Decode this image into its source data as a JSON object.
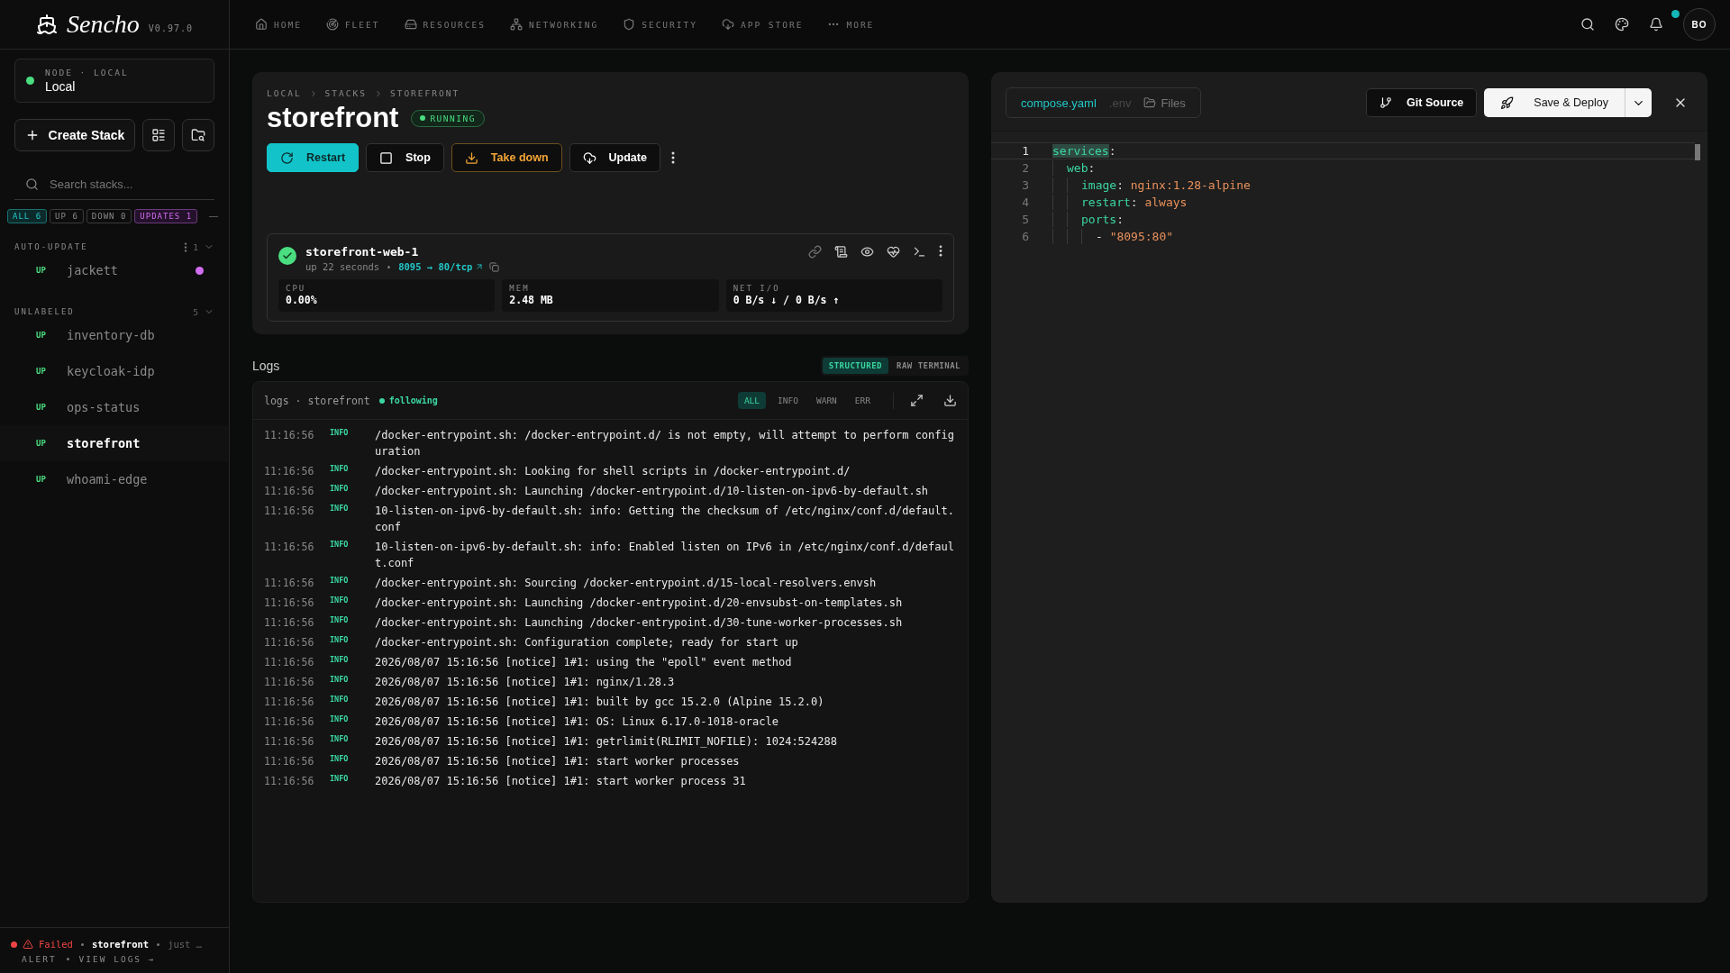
{
  "brand": {
    "name": "Sencho",
    "version": "V0.97.0"
  },
  "node": {
    "label": "NODE · LOCAL",
    "name": "Local",
    "online": true
  },
  "sidebar": {
    "create_label": "Create Stack",
    "search_placeholder": "Search stacks...",
    "filters": [
      {
        "label": "ALL",
        "count": "6",
        "selected": true,
        "kind": "all"
      },
      {
        "label": "UP",
        "count": "6",
        "selected": false,
        "kind": "status"
      },
      {
        "label": "DOWN",
        "count": "0",
        "selected": false,
        "kind": "status"
      },
      {
        "label": "UPDATES",
        "count": "1",
        "selected": false,
        "kind": "updates"
      }
    ],
    "groups": [
      {
        "label": "AUTO-UPDATE",
        "count": "1",
        "menu": true,
        "items": [
          {
            "status": "UP",
            "name": "jackett",
            "selected": false,
            "update_dot": true
          }
        ]
      },
      {
        "label": "UNLABELED",
        "count": "5",
        "menu": false,
        "items": [
          {
            "status": "UP",
            "name": "inventory-db",
            "selected": false,
            "update_dot": false
          },
          {
            "status": "UP",
            "name": "keycloak-idp",
            "selected": false,
            "update_dot": false
          },
          {
            "status": "UP",
            "name": "ops-status",
            "selected": false,
            "update_dot": false
          },
          {
            "status": "UP",
            "name": "storefront",
            "selected": true,
            "update_dot": false
          },
          {
            "status": "UP",
            "name": "whoami-edge",
            "selected": false,
            "update_dot": false
          }
        ]
      }
    ],
    "alert": {
      "status": "Failed",
      "stack": "storefront",
      "time": "just …",
      "label": "ALERT",
      "link": "VIEW LOGS →"
    }
  },
  "top_nav": {
    "items": [
      {
        "label": "HOME"
      },
      {
        "label": "FLEET"
      },
      {
        "label": "RESOURCES"
      },
      {
        "label": "NETWORKING"
      },
      {
        "label": "SECURITY"
      },
      {
        "label": "APP STORE"
      },
      {
        "label": "MORE"
      }
    ],
    "notification_dot": true,
    "avatar": "BO"
  },
  "stack": {
    "breadcrumb": [
      "LOCAL",
      "STACKS",
      "STOREFRONT"
    ],
    "title": "storefront",
    "status": "RUNNING",
    "actions": [
      {
        "label": "Restart",
        "kind": "primary"
      },
      {
        "label": "Stop",
        "kind": "stop"
      },
      {
        "label": "Take down",
        "kind": "warning"
      },
      {
        "label": "Update",
        "kind": "update"
      }
    ],
    "container": {
      "name": "storefront-web-1",
      "healthy": true,
      "uptime": "up 22 seconds",
      "ports": "8095 → 80/tcp",
      "metrics": [
        {
          "label": "CPU",
          "value": "0.00%"
        },
        {
          "label": "MEM",
          "value": "2.48 MB"
        },
        {
          "label": "NET I/O",
          "value": "0 B/s ↓ / 0 B/s ↑"
        }
      ]
    }
  },
  "logs": {
    "title": "Logs",
    "modes": [
      {
        "label": "STRUCTURED",
        "selected": true
      },
      {
        "label": "RAW TERMINAL",
        "selected": false
      }
    ],
    "source": "logs · storefront",
    "following": "following",
    "levels": [
      {
        "label": "ALL",
        "selected": true
      },
      {
        "label": "INFO",
        "selected": false
      },
      {
        "label": "WARN",
        "selected": false
      },
      {
        "label": "ERR",
        "selected": false
      }
    ],
    "rows": [
      {
        "time": "11:16:56",
        "level": "INFO",
        "message": "/docker-entrypoint.sh: /docker-entrypoint.d/ is not empty, will attempt to perform configuration"
      },
      {
        "time": "11:16:56",
        "level": "INFO",
        "message": "/docker-entrypoint.sh: Looking for shell scripts in /docker-entrypoint.d/"
      },
      {
        "time": "11:16:56",
        "level": "INFO",
        "message": "/docker-entrypoint.sh: Launching /docker-entrypoint.d/10-listen-on-ipv6-by-default.sh"
      },
      {
        "time": "11:16:56",
        "level": "INFO",
        "message": "10-listen-on-ipv6-by-default.sh: info: Getting the checksum of /etc/nginx/conf.d/default.conf"
      },
      {
        "time": "11:16:56",
        "level": "INFO",
        "message": "10-listen-on-ipv6-by-default.sh: info: Enabled listen on IPv6 in /etc/nginx/conf.d/default.conf"
      },
      {
        "time": "11:16:56",
        "level": "INFO",
        "message": "/docker-entrypoint.sh: Sourcing /docker-entrypoint.d/15-local-resolvers.envsh"
      },
      {
        "time": "11:16:56",
        "level": "INFO",
        "message": "/docker-entrypoint.sh: Launching /docker-entrypoint.d/20-envsubst-on-templates.sh"
      },
      {
        "time": "11:16:56",
        "level": "INFO",
        "message": "/docker-entrypoint.sh: Launching /docker-entrypoint.d/30-tune-worker-processes.sh"
      },
      {
        "time": "11:16:56",
        "level": "INFO",
        "message": "/docker-entrypoint.sh: Configuration complete; ready for start up"
      },
      {
        "time": "11:16:56",
        "level": "INFO",
        "message": "2026/08/07 15:16:56 [notice] 1#1: using the \"epoll\" event method"
      },
      {
        "time": "11:16:56",
        "level": "INFO",
        "message": "2026/08/07 15:16:56 [notice] 1#1: nginx/1.28.3"
      },
      {
        "time": "11:16:56",
        "level": "INFO",
        "message": "2026/08/07 15:16:56 [notice] 1#1: built by gcc 15.2.0 (Alpine 15.2.0)"
      },
      {
        "time": "11:16:56",
        "level": "INFO",
        "message": "2026/08/07 15:16:56 [notice] 1#1: OS: Linux 6.17.0-1018-oracle"
      },
      {
        "time": "11:16:56",
        "level": "INFO",
        "message": "2026/08/07 15:16:56 [notice] 1#1: getrlimit(RLIMIT_NOFILE): 1024:524288"
      },
      {
        "time": "11:16:56",
        "level": "INFO",
        "message": "2026/08/07 15:16:56 [notice] 1#1: start worker processes"
      },
      {
        "time": "11:16:56",
        "level": "INFO",
        "message": "2026/08/07 15:16:56 [notice] 1#1: start worker process 31"
      }
    ]
  },
  "editor": {
    "tabs": [
      {
        "label": "compose.yaml",
        "selected": true,
        "disabled": false,
        "kind": "file"
      },
      {
        "label": ".env",
        "selected": false,
        "disabled": true,
        "kind": "file"
      },
      {
        "label": "Files",
        "selected": false,
        "disabled": false,
        "kind": "folder"
      }
    ],
    "git_label": "Git Source",
    "deploy_label": "Save & Deploy",
    "lines": [
      {
        "number": "1",
        "active": true,
        "tokens": [
          {
            "kind": "key",
            "text": "services"
          },
          {
            "kind": "punct",
            "text": ":"
          }
        ],
        "children": [
          {
            "number": "2",
            "active": false,
            "tokens": [
              {
                "kind": "key",
                "text": "web"
              },
              {
                "kind": "punct",
                "text": ":"
              }
            ],
            "children": [
              {
                "number": "3",
                "active": false,
                "tokens": [
                  {
                    "kind": "key",
                    "text": "image"
                  },
                  {
                    "kind": "punct",
                    "text": ":"
                  },
                  {
                    "kind": "value",
                    "text": "nginx:1.28-alpine"
                  }
                ]
              },
              {
                "number": "4",
                "active": false,
                "tokens": [
                  {
                    "kind": "key",
                    "text": "restart"
                  },
                  {
                    "kind": "punct",
                    "text": ":"
                  },
                  {
                    "kind": "value",
                    "text": "always"
                  }
                ]
              },
              {
                "number": "5",
                "active": false,
                "tokens": [
                  {
                    "kind": "key",
                    "text": "ports"
                  },
                  {
                    "kind": "punct",
                    "text": ":"
                  }
                ],
                "children": [
                  {
                    "number": "6",
                    "active": false,
                    "tokens": [
                      {
                        "kind": "punct",
                        "text": "-"
                      },
                      {
                        "kind": "value",
                        "text": "\"8095:80\""
                      }
                    ]
                  }
                ]
              }
            ]
          }
        ]
      }
    ]
  }
}
